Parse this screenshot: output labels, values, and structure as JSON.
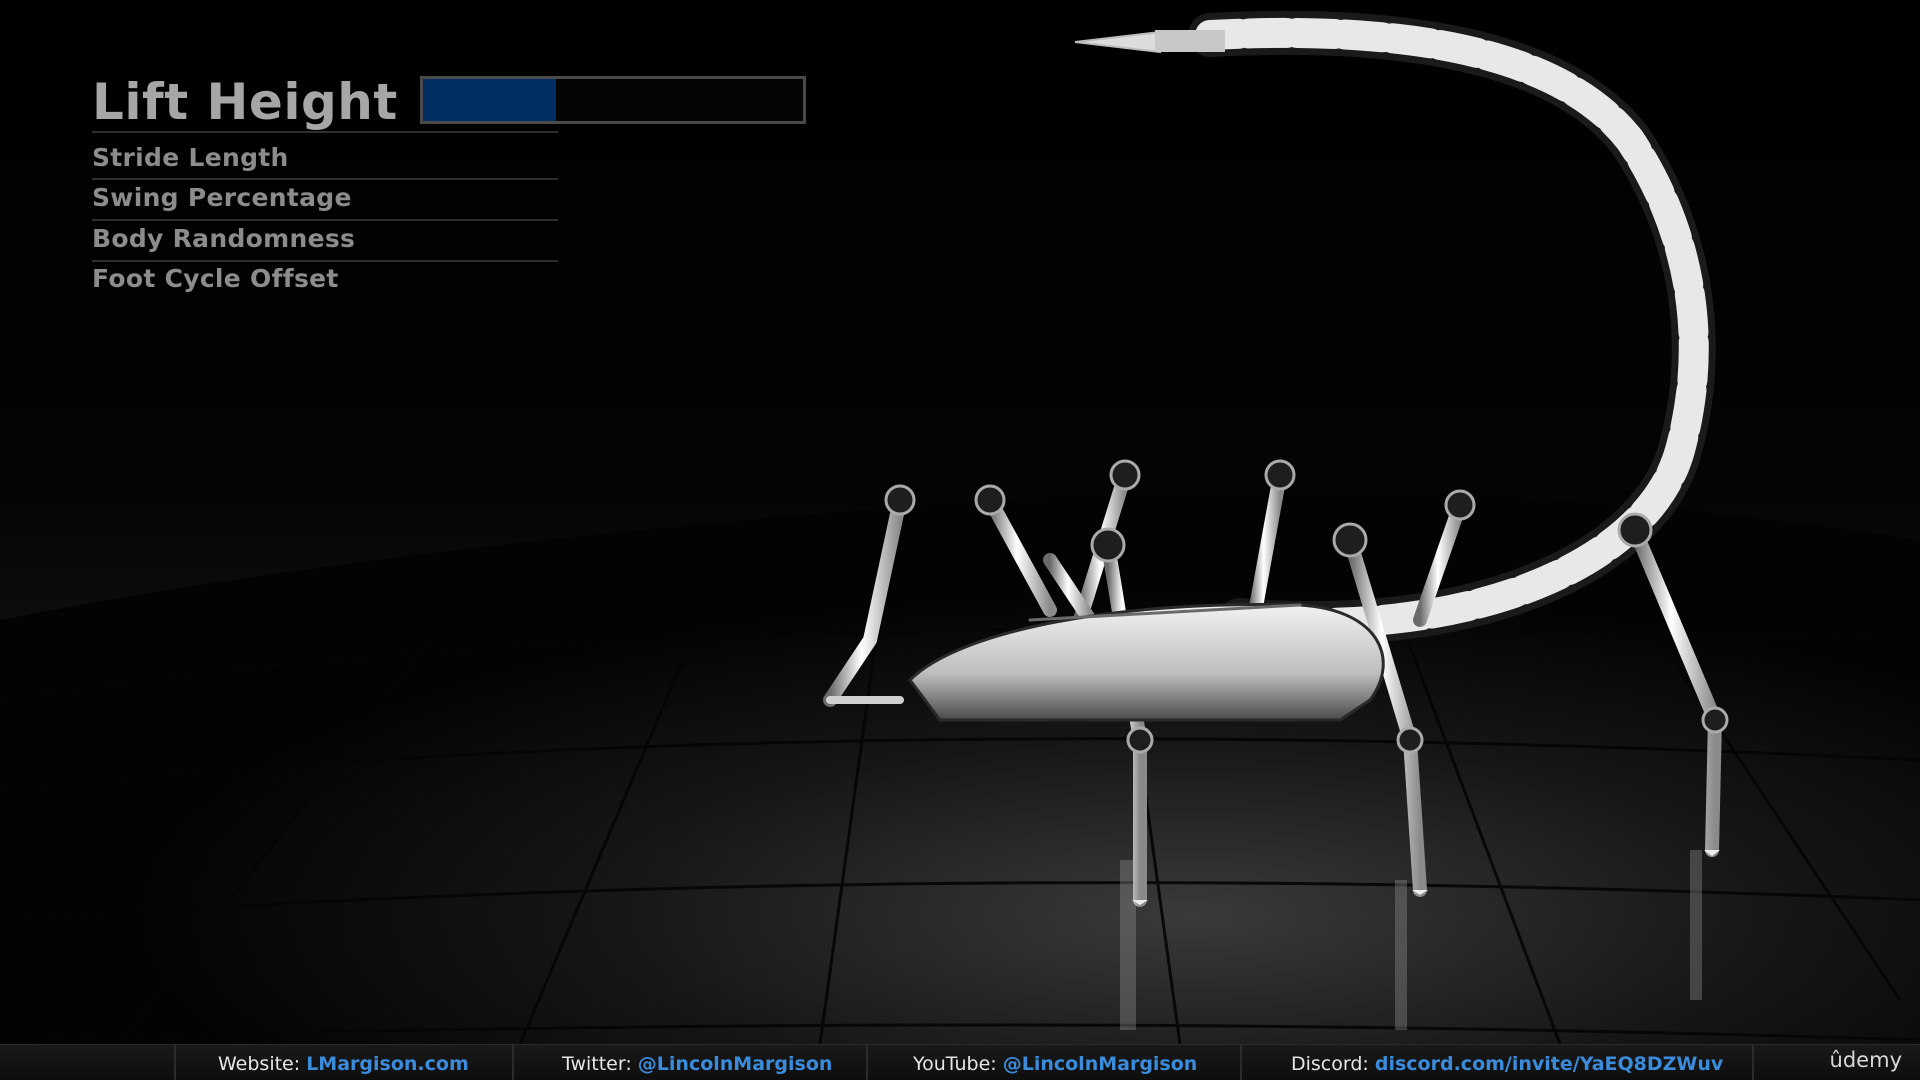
{
  "menu": {
    "title": "Lift Height",
    "progress": 0.35,
    "bar_color": "#002e63",
    "items": [
      "Stride Length",
      "Swing Percentage",
      "Body Randomness",
      "Foot Cycle Offset"
    ]
  },
  "footer": {
    "website_label": "Website:",
    "website_link": "LMargison.com",
    "twitter_label": "Twitter:",
    "twitter_link": "@LincolnMargison",
    "youtube_label": "YouTube:",
    "youtube_link": "@LincolnMargison",
    "discord_label": "Discord:",
    "discord_link": "discord.com/invite/YaEQ8DZWuv",
    "brand": "ûdemy",
    "link_color": "#3b8bdb"
  },
  "scene": {
    "subject": "mechanical-scorpion-robot",
    "floor": "dark-reflective-tiles"
  }
}
